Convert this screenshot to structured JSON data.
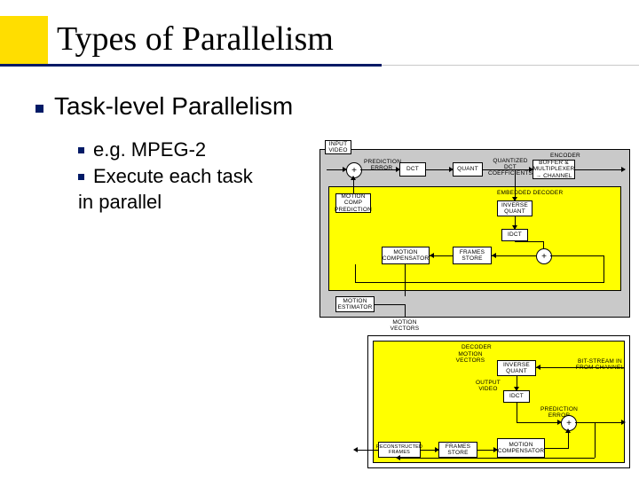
{
  "title": "Types of Parallelism",
  "bullet1": "Task-level Parallelism",
  "bullet2a": "e.g. MPEG-2",
  "bullet2b": "Execute each task",
  "bullet2c": "in parallel",
  "diagram": {
    "encoder": {
      "input_video": "INPUT\nVIDEO",
      "label": "ENCODER",
      "sub": "+",
      "prediction_error": "PREDICTION\nERROR",
      "dct": "DCT",
      "quant": "QUANT",
      "quantized_dct": "QUANTIZED DCT\nCOEFFICIENTS",
      "buffer_channel": "BUFFER &\nMULTIPLEXER\n→ CHANNEL",
      "embedded_decoder": "EMBEDDED DECODER",
      "inverse_quant": "INVERSE\nQUANT",
      "idct": "IDCT",
      "motion_comp_pred": "MOTION\nCOMP\nPREDICTION",
      "motion_compensator": "MOTION\nCOMPENSATOR",
      "frames_store": "FRAMES\nSTORE",
      "add": "+",
      "motion_estimator": "MOTION\nESTIMATOR",
      "motion_vectors": "MOTION\nVECTORS"
    },
    "decoder": {
      "label": "DECODER",
      "motion_vectors": "MOTION\nVECTORS",
      "bit_stream_in": "BIT-STREAM IN\nFROM CHANNEL",
      "inverse_quant": "INVERSE\nQUANT",
      "output_video": "OUTPUT\nVIDEO",
      "idct": "IDCT",
      "prediction_error": "PREDICTION\nERROR",
      "add": "+",
      "reconstructed": "RECONSTRUCTED\nFRAMES",
      "frames_store": "FRAMES\nSTORE",
      "motion_compensator": "MOTION\nCOMPENSATOR"
    }
  }
}
